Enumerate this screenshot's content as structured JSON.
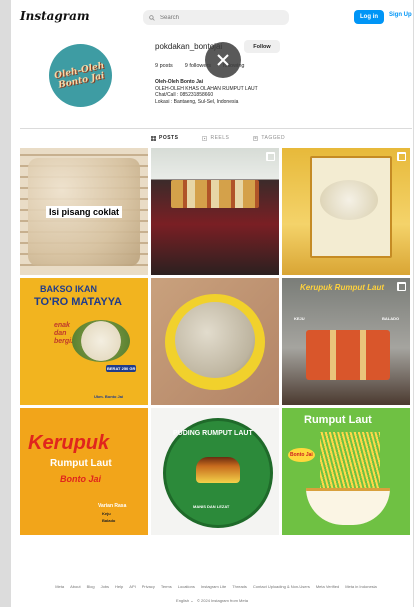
{
  "header": {
    "logo": "Instagram",
    "search_placeholder": "Search",
    "login_label": "Log in",
    "signup_label": "Sign Up"
  },
  "profile": {
    "avatar_line1": "Oleh-Oleh",
    "avatar_line2": "Bonto Jai",
    "username": "pokdakan_bontojai",
    "follow_label": "Follow",
    "posts": "9 posts",
    "followers": "9 followers",
    "following": "following",
    "bio_name": "Oleh-Oleh Bonto Jai",
    "bio_line1": "OLEH-OLEH KHAS OLAHAN RUMPUT LAUT",
    "bio_line2": "Chat/Call : 085231858660",
    "bio_line3": "Lokasi : Bantaeng, Sul-Sel, Indonesia"
  },
  "tabs": {
    "posts": "POSTS",
    "reels": "REELS",
    "tagged": "TAGGED"
  },
  "posts": {
    "p1_caption": "Isi pisang coklat",
    "p4_title1": "BAKSO IKAN",
    "p4_title2": "TO'RO MATAYYA",
    "p4_tag1": "enak",
    "p4_tag2": "dan",
    "p4_tag3": "bergizi",
    "p4_weight": "BERAT 250 GR",
    "p4_contact": "Ukm. Bonto Jai",
    "p6_title": "Kerupuk Rumput Laut",
    "p6_label1": "KEJU",
    "p6_label2": "BALADO",
    "p7_title1": "Kerupuk",
    "p7_title2": "Rumput Laut",
    "p7_title3": "Bonto Jai",
    "p7_variant": "Varian Rasa",
    "p7_v1": "Keju",
    "p7_v2": "Balado",
    "p8_title": "PUDING RUMPUT LAUT",
    "p8_sub": "MANIS DAN LEZAT",
    "p9_title": "Rumput Laut",
    "p9_badge": "Bonto Jai"
  },
  "footer": {
    "links": [
      "Meta",
      "About",
      "Blog",
      "Jobs",
      "Help",
      "API",
      "Privacy",
      "Terms",
      "Locations",
      "Instagram Lite",
      "Threads",
      "Contact Uploading & Non-Users",
      "Meta Verified",
      "Meta in Indonesia"
    ],
    "language": "English",
    "copyright": "© 2024 Instagram from Meta"
  },
  "colors": {
    "accent": "#0095f6",
    "avatar_bg": "#3e9ca3"
  }
}
